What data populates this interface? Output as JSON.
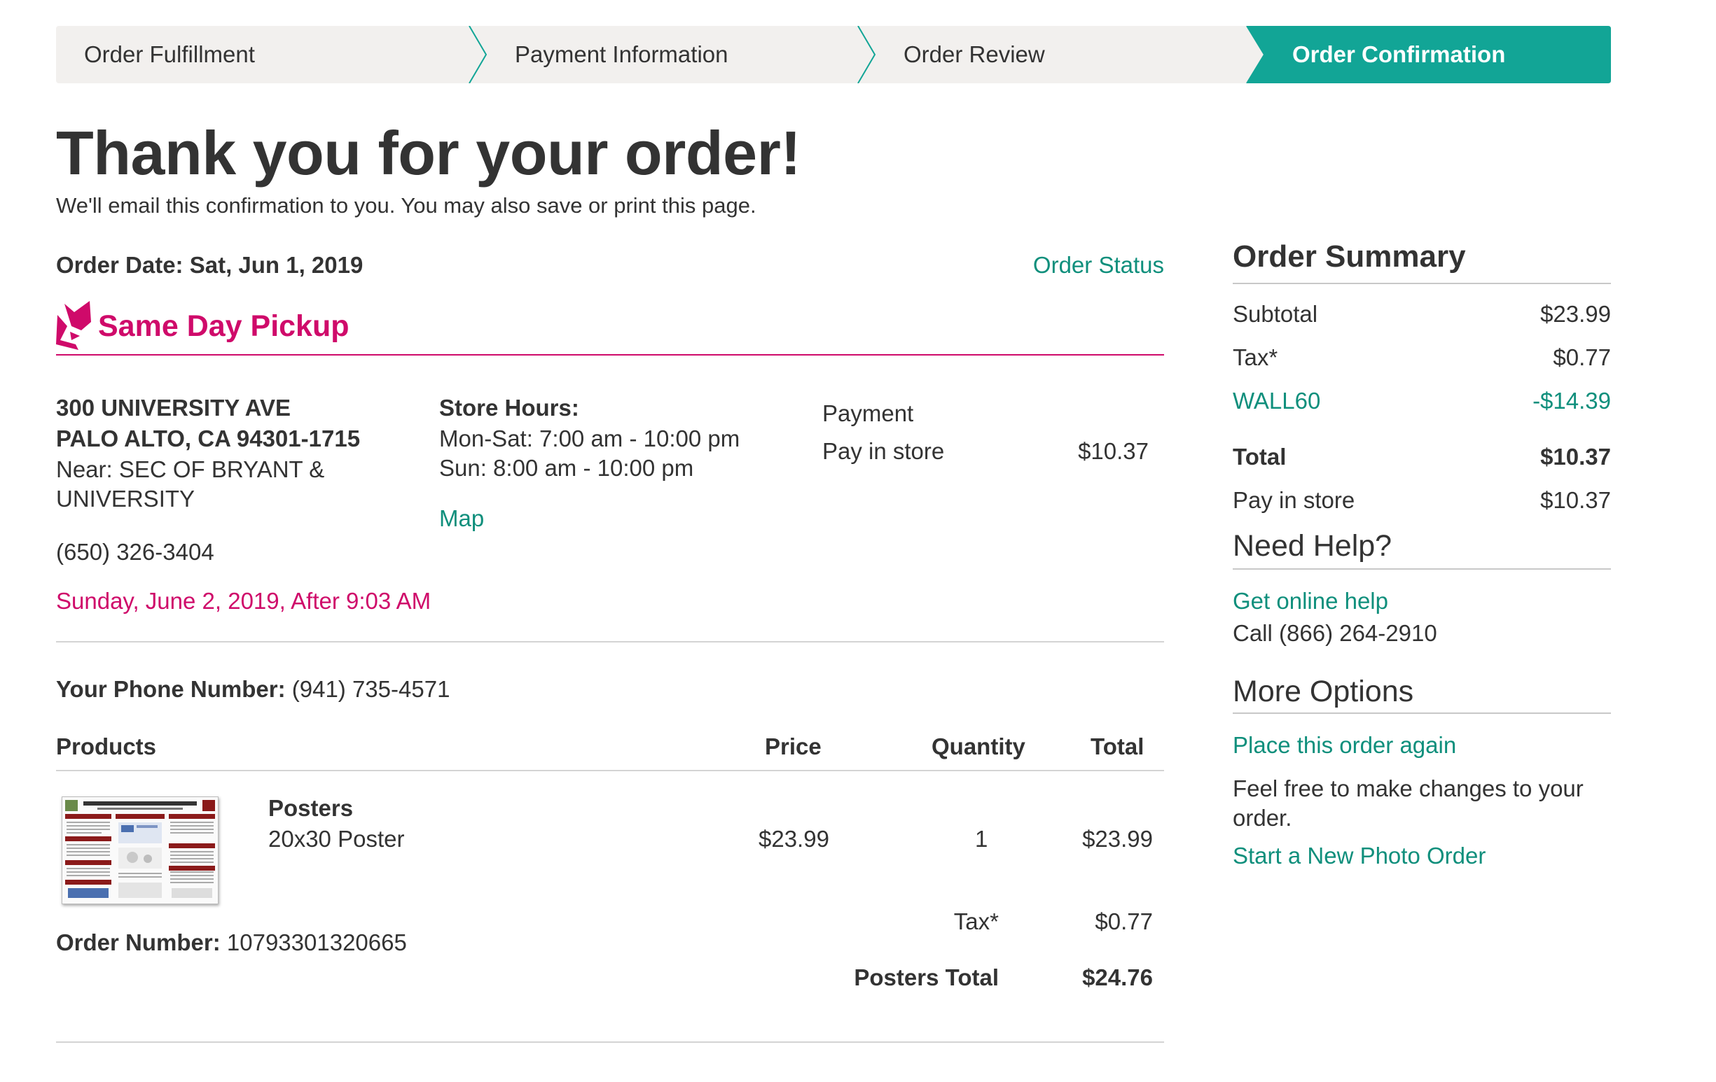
{
  "progress": {
    "steps": [
      "Order Fulfillment",
      "Payment Information",
      "Order Review",
      "Order Confirmation"
    ],
    "active_index": 3,
    "active_color": "#12a596",
    "inactive_color": "#f2f0ee"
  },
  "header": {
    "title": "Thank you for your order!",
    "subtitle": "We'll email this confirmation to you. You may also save or print this page."
  },
  "order": {
    "date_label": "Order Date: Sat, Jun 1, 2019",
    "status_link": "Order Status",
    "pickup_label": "Same Day Pickup",
    "store": {
      "address1": "300 UNIVERSITY AVE",
      "address2": "PALO ALTO, CA 94301-1715",
      "near1": "Near: SEC OF BRYANT &",
      "near2": "UNIVERSITY",
      "phone": "(650) 326-3404",
      "pickup_time": "Sunday, June 2, 2019, After 9:03 AM"
    },
    "hours": {
      "label": "Store Hours:",
      "line1": "Mon-Sat: 7:00 am - 10:00 pm",
      "line2": "Sun: 8:00 am - 10:00 pm",
      "map_link": "Map"
    },
    "payment": {
      "label": "Payment",
      "method": "Pay in store",
      "amount": "$10.37"
    },
    "your_phone_label": "Your Phone Number:",
    "your_phone": "(941) 735-4571",
    "table": {
      "headers": {
        "products": "Products",
        "price": "Price",
        "quantity": "Quantity",
        "total": "Total"
      },
      "item": {
        "name": "Posters",
        "variant": "20x30 Poster",
        "price": "$23.99",
        "quantity": "1",
        "total": "$23.99"
      },
      "tax_label": "Tax*",
      "tax_value": "$0.77",
      "group_total_label": "Posters Total",
      "group_total_value": "$24.76"
    },
    "number_label": "Order Number:",
    "number": "10793301320665"
  },
  "summary": {
    "title": "Order Summary",
    "subtotal_label": "Subtotal",
    "subtotal": "$23.99",
    "tax_label": "Tax*",
    "tax": "$0.77",
    "promo_label": "WALL60",
    "promo": "-$14.39",
    "total_label": "Total",
    "total": "$10.37",
    "pay_label": "Pay in store",
    "pay": "$10.37"
  },
  "help": {
    "title": "Need Help?",
    "link": "Get online help",
    "call": "Call (866) 264-2910"
  },
  "more": {
    "title": "More Options",
    "reorder_link": "Place this order again",
    "note1": "Feel free to make changes to your",
    "note2": "order.",
    "new_order_link": "Start a New Photo Order"
  }
}
